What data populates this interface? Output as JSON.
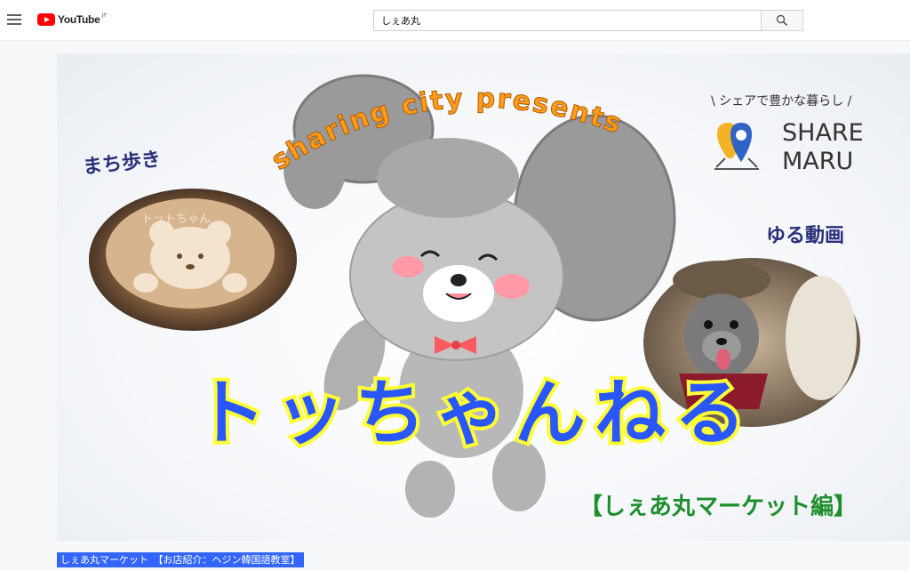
{
  "header": {
    "logo_text": "YouTube",
    "logo_region": "JP",
    "search_value": "しぇあ丸"
  },
  "thumbnail": {
    "top_arc_text": "sharing city presents",
    "tagline": "\\ シェアで豊かな暮らし /",
    "brand_line1": "SHARE",
    "brand_line2": "MARU",
    "left_label": "まち歩き",
    "latte_text": "トットちゃん",
    "right_label": "ゆる動画",
    "main_title": "トッちゃんねる",
    "sub_title": "【しぇあ丸マーケット編】"
  },
  "caption": "しぇあ丸マーケット　【お店紹介：ヘジン韓国語教室】",
  "colors": {
    "youtube_red": "#ff0000",
    "title_blue": "#2956ff",
    "title_glow": "#ffff33",
    "arc_orange": "#ff8a00",
    "subtitle_green": "#1e8f2e",
    "caption_bg": "#3366ff",
    "brand_blue": "#2f63c5",
    "brand_yellow": "#f3b325"
  }
}
